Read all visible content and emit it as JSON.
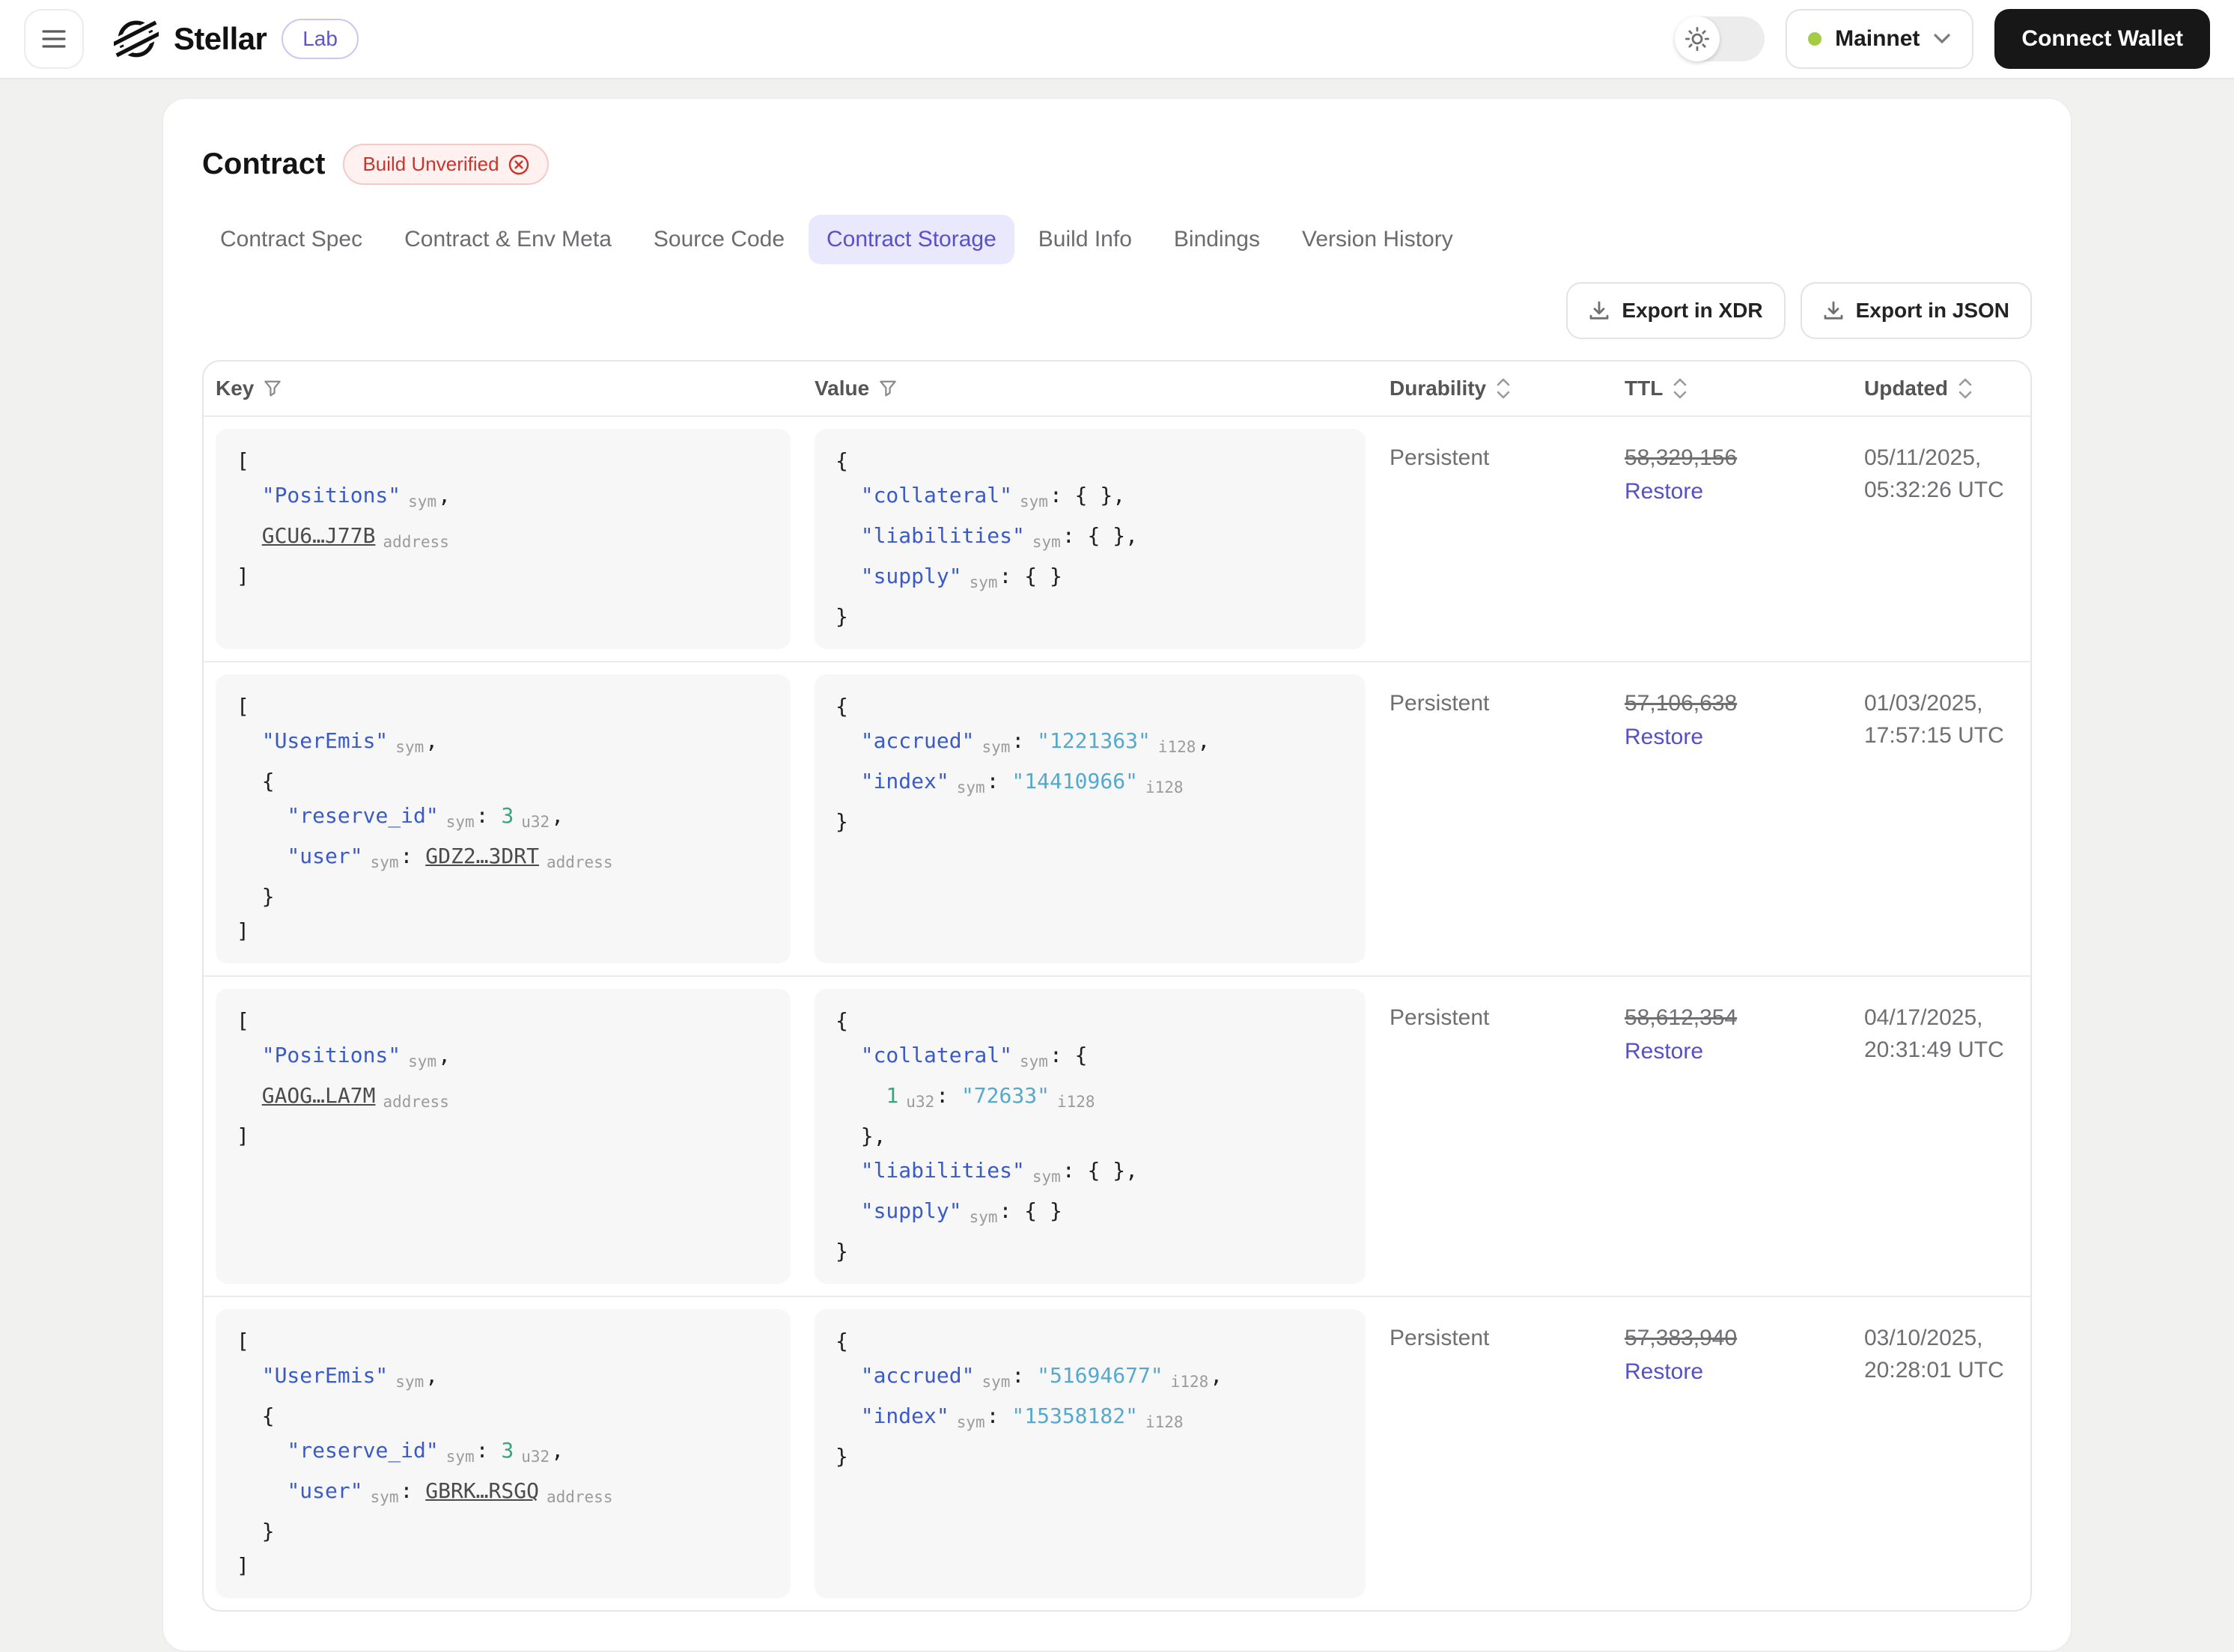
{
  "topbar": {
    "brand": "Stellar",
    "badge": "Lab",
    "network": "Mainnet",
    "connect_wallet": "Connect Wallet"
  },
  "page": {
    "title": "Contract",
    "status_badge": "Build Unverified",
    "active_tab": "Contract Storage",
    "tabs": [
      "Contract Spec",
      "Contract & Env Meta",
      "Source Code",
      "Contract Storage",
      "Build Info",
      "Bindings",
      "Version History"
    ],
    "export_xdr_label": "Export in XDR",
    "export_json_label": "Export in JSON"
  },
  "table": {
    "columns": [
      {
        "label": "Key",
        "icon": "filter"
      },
      {
        "label": "Value",
        "icon": "filter"
      },
      {
        "label": "Durability",
        "icon": "sort"
      },
      {
        "label": "TTL",
        "icon": "sort"
      },
      {
        "label": "Updated",
        "icon": "sort"
      }
    ],
    "restore_label": "Restore",
    "rows": [
      {
        "key_lines": [
          [
            [
              "pu",
              "["
            ]
          ],
          [
            [
              "pu",
              "  "
            ],
            [
              "key",
              "\"Positions\""
            ],
            [
              "typ",
              "sym"
            ],
            [
              "pu",
              ","
            ]
          ],
          [
            [
              "pu",
              "  "
            ],
            [
              "adr",
              "GCU6…J77B"
            ],
            [
              "typ",
              "address"
            ]
          ],
          [
            [
              "pu",
              "]"
            ]
          ]
        ],
        "value_lines": [
          [
            [
              "pu",
              "{"
            ]
          ],
          [
            [
              "pu",
              "  "
            ],
            [
              "key",
              "\"collateral\""
            ],
            [
              "typ",
              "sym"
            ],
            [
              "pu",
              ": { },"
            ]
          ],
          [
            [
              "pu",
              "  "
            ],
            [
              "key",
              "\"liabilities\""
            ],
            [
              "typ",
              "sym"
            ],
            [
              "pu",
              ": { },"
            ]
          ],
          [
            [
              "pu",
              "  "
            ],
            [
              "key",
              "\"supply\""
            ],
            [
              "typ",
              "sym"
            ],
            [
              "pu",
              ": { }"
            ]
          ],
          [
            [
              "pu",
              "}"
            ]
          ]
        ],
        "durability": "Persistent",
        "ttl": "58,329,156",
        "updated": [
          "05/11/2025,",
          "05:32:26 UTC"
        ],
        "min_height": 160
      },
      {
        "key_lines": [
          [
            [
              "pu",
              "["
            ]
          ],
          [
            [
              "pu",
              "  "
            ],
            [
              "key",
              "\"UserEmis\""
            ],
            [
              "typ",
              "sym"
            ],
            [
              "pu",
              ","
            ]
          ],
          [
            [
              "pu",
              "  {"
            ]
          ],
          [
            [
              "pu",
              "    "
            ],
            [
              "key",
              "\"reserve_id\""
            ],
            [
              "typ",
              "sym"
            ],
            [
              "pu",
              ": "
            ],
            [
              "num",
              "3"
            ],
            [
              "typ",
              "u32"
            ],
            [
              "pu",
              ","
            ]
          ],
          [
            [
              "pu",
              "    "
            ],
            [
              "key",
              "\"user\""
            ],
            [
              "typ",
              "sym"
            ],
            [
              "pu",
              ": "
            ],
            [
              "adr",
              "GDZ2…3DRT"
            ],
            [
              "typ",
              "address"
            ]
          ],
          [
            [
              "pu",
              "  }"
            ]
          ],
          [
            [
              "pu",
              "]"
            ]
          ]
        ],
        "value_lines": [
          [
            [
              "pu",
              "{"
            ]
          ],
          [
            [
              "pu",
              "  "
            ],
            [
              "key",
              "\"accrued\""
            ],
            [
              "typ",
              "sym"
            ],
            [
              "pu",
              ": "
            ],
            [
              "str",
              "\"1221363\""
            ],
            [
              "typ",
              "i128"
            ],
            [
              "pu",
              ","
            ]
          ],
          [
            [
              "pu",
              "  "
            ],
            [
              "key",
              "\"index\""
            ],
            [
              "typ",
              "sym"
            ],
            [
              "pu",
              ": "
            ],
            [
              "str",
              "\"14410966\""
            ],
            [
              "typ",
              "i128"
            ]
          ],
          [
            [
              "pu",
              "}"
            ]
          ]
        ],
        "durability": "Persistent",
        "ttl": "57,106,638",
        "updated": [
          "01/03/2025,",
          "17:57:15 UTC"
        ],
        "min_height": 195
      },
      {
        "key_lines": [
          [
            [
              "pu",
              "["
            ]
          ],
          [
            [
              "pu",
              "  "
            ],
            [
              "key",
              "\"Positions\""
            ],
            [
              "typ",
              "sym"
            ],
            [
              "pu",
              ","
            ]
          ],
          [
            [
              "pu",
              "  "
            ],
            [
              "adr",
              "GAOG…LA7M"
            ],
            [
              "typ",
              "address"
            ]
          ],
          [
            [
              "pu",
              "]"
            ]
          ]
        ],
        "value_lines": [
          [
            [
              "pu",
              "{"
            ]
          ],
          [
            [
              "pu",
              "  "
            ],
            [
              "key",
              "\"collateral\""
            ],
            [
              "typ",
              "sym"
            ],
            [
              "pu",
              ": {"
            ]
          ],
          [
            [
              "pu",
              "    "
            ],
            [
              "num",
              "1"
            ],
            [
              "typ",
              "u32"
            ],
            [
              "pu",
              ": "
            ],
            [
              "str",
              "\"72633\""
            ],
            [
              "typ",
              "i128"
            ]
          ],
          [
            [
              "pu",
              "  },"
            ]
          ],
          [
            [
              "pu",
              "  "
            ],
            [
              "key",
              "\"liabilities\""
            ],
            [
              "typ",
              "sym"
            ],
            [
              "pu",
              ": { },"
            ]
          ],
          [
            [
              "pu",
              "  "
            ],
            [
              "key",
              "\"supply\""
            ],
            [
              "typ",
              "sym"
            ],
            [
              "pu",
              ": { }"
            ]
          ],
          [
            [
              "pu",
              "}"
            ]
          ]
        ],
        "durability": "Persistent",
        "ttl": "58,612,354",
        "updated": [
          "04/17/2025,",
          "20:31:49 UTC"
        ],
        "min_height": 198
      },
      {
        "key_lines": [
          [
            [
              "pu",
              "["
            ]
          ],
          [
            [
              "pu",
              "  "
            ],
            [
              "key",
              "\"UserEmis\""
            ],
            [
              "typ",
              "sym"
            ],
            [
              "pu",
              ","
            ]
          ],
          [
            [
              "pu",
              "  {"
            ]
          ],
          [
            [
              "pu",
              "    "
            ],
            [
              "key",
              "\"reserve_id\""
            ],
            [
              "typ",
              "sym"
            ],
            [
              "pu",
              ": "
            ],
            [
              "num",
              "3"
            ],
            [
              "typ",
              "u32"
            ],
            [
              "pu",
              ","
            ]
          ],
          [
            [
              "pu",
              "    "
            ],
            [
              "key",
              "\"user\""
            ],
            [
              "typ",
              "sym"
            ],
            [
              "pu",
              ": "
            ],
            [
              "adr",
              "GBRK…RSGQ"
            ],
            [
              "typ",
              "address"
            ]
          ],
          [
            [
              "pu",
              "  }"
            ]
          ],
          [
            [
              "pu",
              "]"
            ]
          ]
        ],
        "value_lines": [
          [
            [
              "pu",
              "{"
            ]
          ],
          [
            [
              "pu",
              "  "
            ],
            [
              "key",
              "\"accrued\""
            ],
            [
              "typ",
              "sym"
            ],
            [
              "pu",
              ": "
            ],
            [
              "str",
              "\"51694677\""
            ],
            [
              "typ",
              "i128"
            ],
            [
              "pu",
              ","
            ]
          ],
          [
            [
              "pu",
              "  "
            ],
            [
              "key",
              "\"index\""
            ],
            [
              "typ",
              "sym"
            ],
            [
              "pu",
              ": "
            ],
            [
              "str",
              "\"15358182\""
            ],
            [
              "typ",
              "i128"
            ]
          ],
          [
            [
              "pu",
              "}"
            ]
          ]
        ],
        "durability": "Persistent",
        "ttl": "57,383,940",
        "updated": [
          "03/10/2025,",
          "20:28:01 UTC"
        ],
        "min_height": 195
      }
    ]
  },
  "colors": {
    "accent_purple": "#5a50c8",
    "key_blue": "#3a5bc7",
    "value_cyan": "#55a9cc",
    "number_green": "#35a77c",
    "error_red": "#c9342b",
    "network_dot_green": "#a4cd43"
  }
}
